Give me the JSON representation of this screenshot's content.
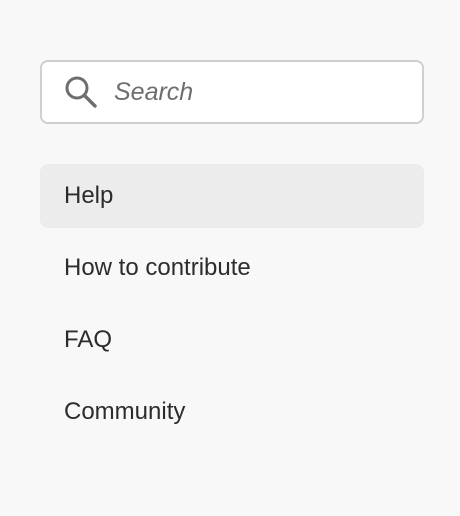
{
  "search": {
    "placeholder": "Search",
    "value": "",
    "icon": "search-icon"
  },
  "nav": {
    "selected_index": 0,
    "items": [
      {
        "label": "Help"
      },
      {
        "label": "How to contribute"
      },
      {
        "label": "FAQ"
      },
      {
        "label": "Community"
      }
    ]
  },
  "colors": {
    "background": "#f8f8f8",
    "selected_background": "#ececec",
    "text": "#2c2c2c",
    "placeholder": "#6e6e6e",
    "border": "#cfcfcf"
  }
}
